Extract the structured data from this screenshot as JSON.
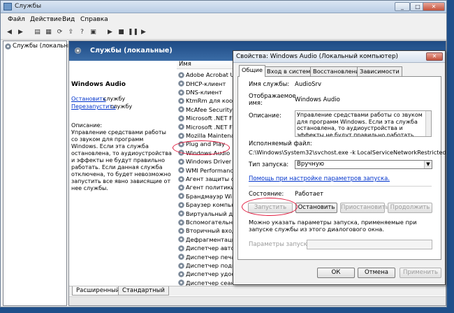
{
  "window": {
    "title": "Службы"
  },
  "menu": [
    "Файл",
    "Действие",
    "Вид",
    "Справка"
  ],
  "tree": {
    "root": "Службы (локальны"
  },
  "pane": {
    "header": "Службы (локальные)"
  },
  "detail": {
    "service_name": "Windows Audio",
    "stop_link": "Остановить",
    "stop_suffix": " службу",
    "restart_link": "Перезапустить",
    "restart_suffix": " службу",
    "desc_heading": "Описание:",
    "desc_text": "Управление средствами работы со звуком для программ Windows. Если эта служба остановлена, то аудиоустройства и эффекты не будут правильно работать. Если данная служба отключена, то будет невозможно запустить все явно зависящие от нее службы."
  },
  "list": {
    "column": "Имя",
    "items": [
      "Adobe Acrobat Upd",
      "DHCP-клиент",
      "DNS-клиент",
      "KtmRm для коорд..",
      "McAfee Security Sc",
      "Microsoft .NET Fra...",
      "Microsoft .NET Fra...",
      "Mozilla Maintenanc...",
      "Plug and Play",
      "Windows Audio",
      "Windows Driver Fo...",
      "WMI Performance ...",
      "Агент защиты сет",
      "Агент политики IP",
      "Брандмауэр Windo",
      "Браузер компьют...",
      "Виртуальный диск",
      "Вспомогательная ...",
      "Вторичный вход в",
      "Дефрагментация ...",
      "Диспетчер автома",
      "Диспетчер печати",
      "Диспетчер подклю",
      "Диспетчер удосто",
      "Диспетчер сеансо"
    ]
  },
  "bottom_tabs": [
    "Расширенный",
    "Стандартный"
  ],
  "dialog": {
    "title": "Свойства: Windows Audio (Локальный компьютер)",
    "tabs": [
      "Общие",
      "Вход в систему",
      "Восстановление",
      "Зависимости"
    ],
    "service_name_label": "Имя службы:",
    "service_name_value": "AudioSrv",
    "display_label1": "Отображаемое",
    "display_label2": "имя:",
    "display_value": "Windows Audio",
    "description_label": "Описание:",
    "description_text": "Управление средствами работы со звуком для программ Windows. Если эта служба остановлена, то аудиоустройства и эффекты не будут правильно работать. Если данная служба",
    "exe_label": "Исполняемый файл:",
    "exe_value": "C:\\Windows\\System32\\svchost.exe -k LocalServiceNetworkRestricted",
    "startup_label": "Тип запуска:",
    "startup_value": "Вручную",
    "help_link": "Помощь при настройке параметров запуска.",
    "state_label": "Состояние:",
    "state_value": "Работает",
    "btn_start": "Запустить",
    "btn_stop": "Остановить",
    "btn_pause": "Приостановить",
    "btn_resume": "Продолжить",
    "hint": "Можно указать параметры запуска, применяемые при запуске службы из этого диалогового окна.",
    "params_label": "Параметры запуска:",
    "ok": "ОК",
    "cancel": "Отмена",
    "apply": "Применить"
  }
}
